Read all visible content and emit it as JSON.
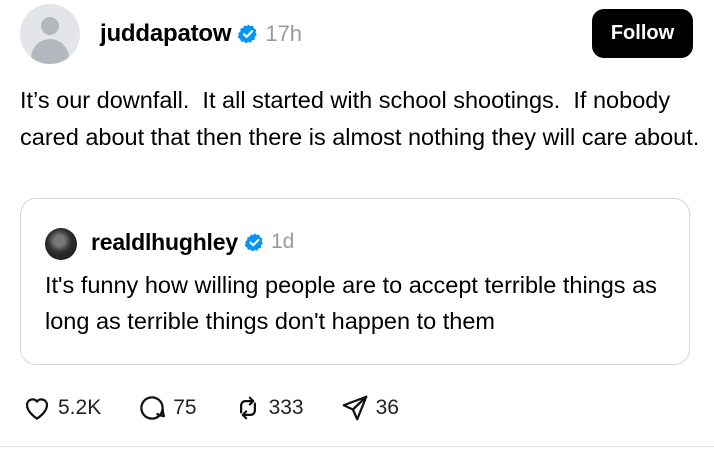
{
  "author": {
    "username": "juddapatow",
    "time": "17h",
    "verified": true
  },
  "follow_label": "Follow",
  "post_text": "It’s our downfall.  It all started with school shootings.  If nobody cared about that then there is almost nothing they will care about.",
  "quote": {
    "username": "realdlhughley",
    "time": "1d",
    "verified": true,
    "text": "It's funny how willing people are to accept terrible things as long as terrible things don't happen to them"
  },
  "actions": {
    "likes": "5.2K",
    "replies": "75",
    "reposts": "333",
    "shares": "36"
  },
  "colors": {
    "verified_badge": "#0095f6",
    "follow_button": "#000000",
    "muted_text": "#9a9a9a",
    "quote_border": "#d6d6d6"
  },
  "icons": [
    "heart-icon",
    "reply-icon",
    "repost-icon",
    "share-icon",
    "verified-badge-icon"
  ]
}
